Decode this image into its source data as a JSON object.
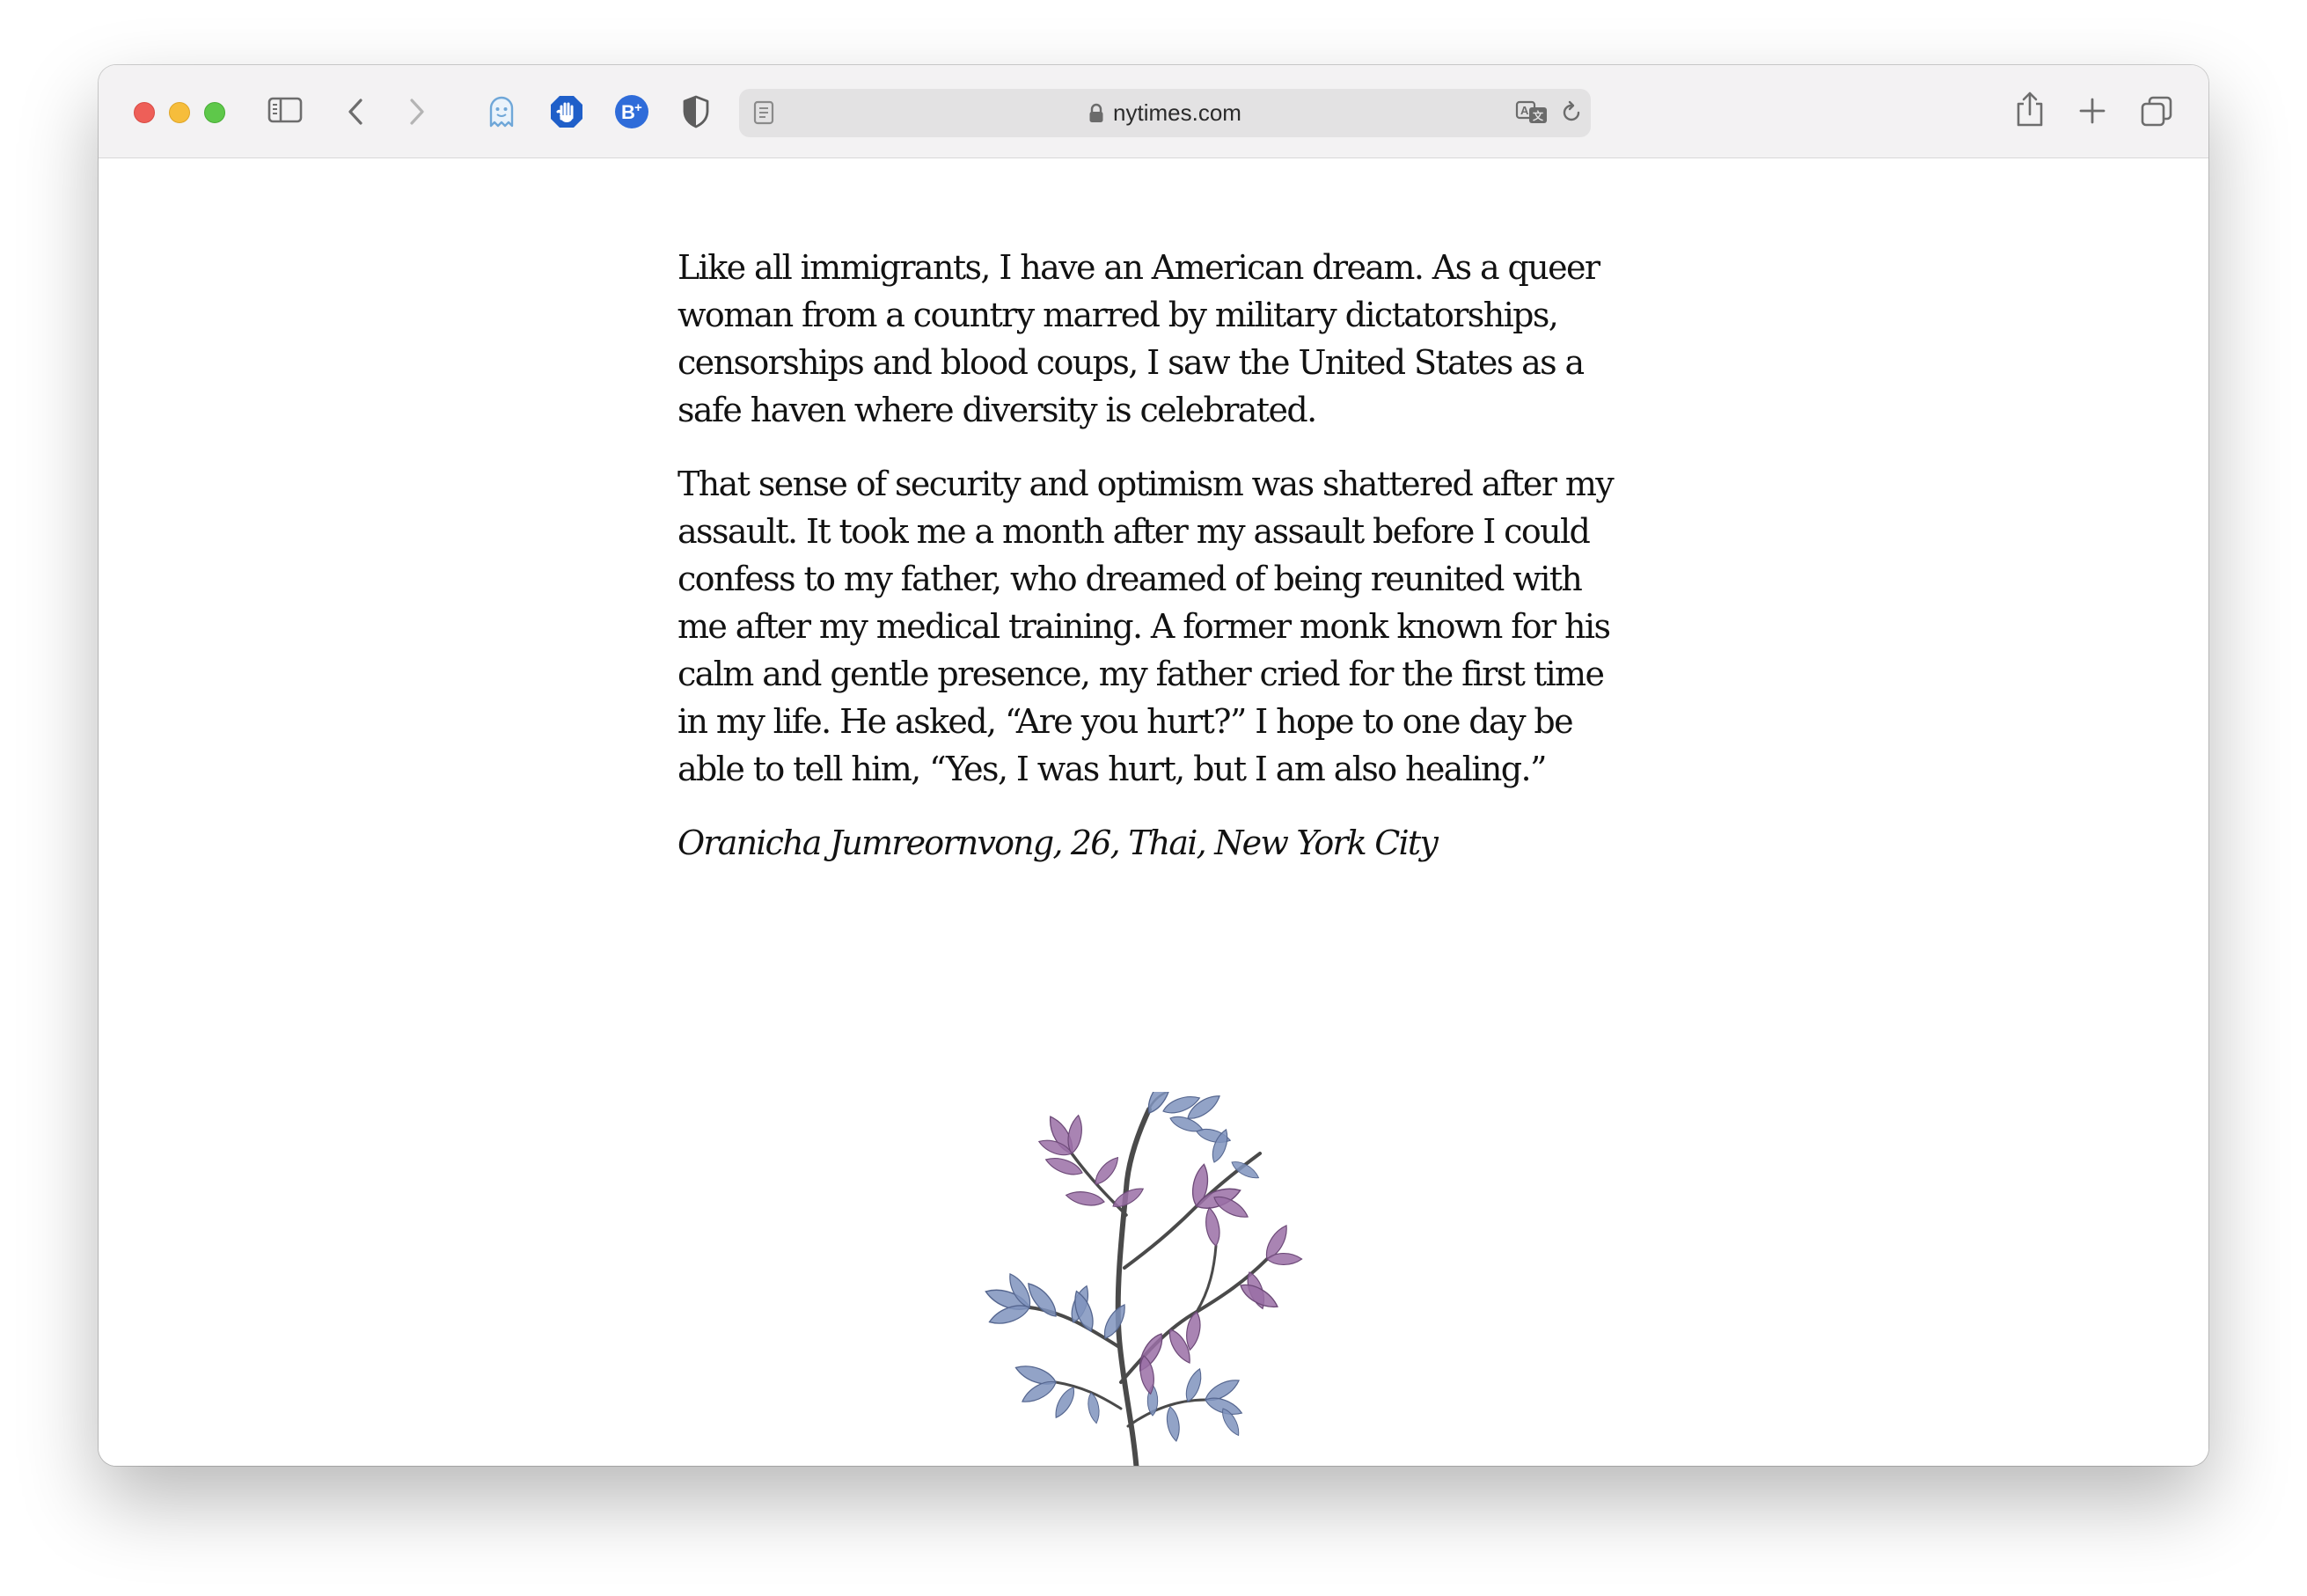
{
  "browser": {
    "url": "nytimes.com"
  },
  "article": {
    "paragraphs": [
      "Like all immigrants, I have an American dream. As a queer woman from a country marred by military dictatorships, censorships and blood coups, I saw the United States as a safe haven where diversity is celebrated.",
      "That sense of security and optimism was shattered after my assault. It took me a month after my assault before I could confess to my father, who dreamed of being reunited with me after my medical training. A former monk known for his calm and gentle presence, my father cried for the first time in my life. He asked, “Are you hurt?” I hope to one day be able to tell him, “Yes, I was hurt, but I am also healing.”"
    ],
    "byline": "Oranicha Jumreornvong, 26, Thai, New York City"
  },
  "colors": {
    "purple_leaf": "#9a6fa6",
    "blue_leaf": "#7f93bd",
    "branch": "#4a4a4a"
  },
  "icons": {
    "sidebar": "sidebar-icon",
    "back": "chevron-left-icon",
    "forward": "chevron-right-icon",
    "ghostery": "ghost-icon",
    "adblock": "hand-stop-icon",
    "bplus": "b-plus-icon",
    "privacy": "shield-icon",
    "reader": "reader-icon",
    "lock": "lock-icon",
    "translate": "translate-icon",
    "reload": "reload-icon",
    "share": "share-icon",
    "new_tab": "plus-icon",
    "tabs": "tab-overview-icon"
  }
}
